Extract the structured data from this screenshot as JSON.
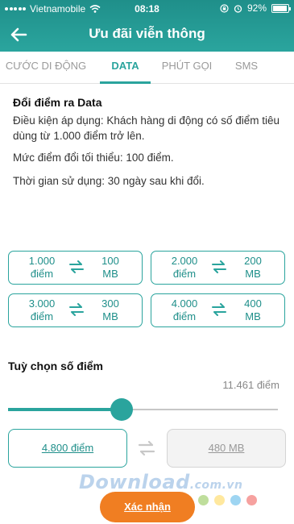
{
  "status_bar": {
    "carrier": "Vietnamobile",
    "time": "08:18",
    "battery": "92%",
    "battery_level": 0.92
  },
  "header": {
    "title": "Ưu đãi viễn thông"
  },
  "tabs": [
    {
      "label": "CƯỚC DI ĐỘNG",
      "active": false
    },
    {
      "label": "DATA",
      "active": true
    },
    {
      "label": "PHÚT GỌI",
      "active": false
    },
    {
      "label": "SMS",
      "active": false
    }
  ],
  "content": {
    "section_title": "Đổi điểm ra Data",
    "condition": "Điều kiện áp dụng: Khách hàng di động có số điểm tiêu dùng từ 1.000 điểm trở lên.",
    "min_points": "Mức điểm đổi tối thiểu: 100 điểm.",
    "usage_time": "Thời gian sử dụng: 30 ngày sau khi đổi."
  },
  "options": [
    {
      "points": "1.000",
      "unit": "điểm",
      "mb": "100",
      "mb_unit": "MB"
    },
    {
      "points": "2.000",
      "unit": "điểm",
      "mb": "200",
      "mb_unit": "MB"
    },
    {
      "points": "3.000",
      "unit": "điểm",
      "mb": "300",
      "mb_unit": "MB"
    },
    {
      "points": "4.000",
      "unit": "điểm",
      "mb": "400",
      "mb_unit": "MB"
    }
  ],
  "custom": {
    "title": "Tuỳ chọn số điểm",
    "max_points": "11.461 điểm",
    "slider_fraction": 0.42,
    "points_value": "4.800 điểm",
    "mb_value": "480 MB"
  },
  "confirm_label": "Xác nhận",
  "watermark": {
    "text": "Download",
    "suffix": ".com.vn"
  },
  "colors": {
    "primary": "#2aa49d",
    "accent": "#f07e22"
  },
  "icons": {
    "back": "arrow-left-icon",
    "swap": "swap-arrows-icon"
  }
}
